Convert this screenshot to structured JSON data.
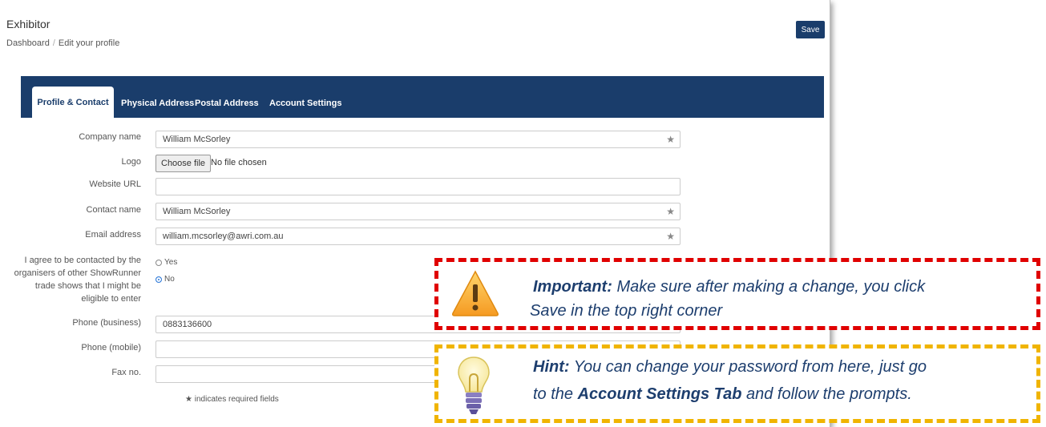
{
  "header": {
    "title": "Exhibitor",
    "breadcrumb": [
      "Dashboard",
      "Edit your profile"
    ],
    "save_label": "Save"
  },
  "tabs": [
    {
      "label": "Profile & Contact",
      "active": true
    },
    {
      "label": "Physical Address"
    },
    {
      "label": "Postal Address"
    },
    {
      "label": "Account Settings"
    }
  ],
  "form": {
    "company_name": {
      "label": "Company name",
      "value": "William McSorley"
    },
    "logo": {
      "label": "Logo",
      "button": "Choose file",
      "status": "No file chosen"
    },
    "website": {
      "label": "Website URL",
      "value": ""
    },
    "contact_name": {
      "label": "Contact name",
      "value": "William McSorley"
    },
    "email": {
      "label": "Email address",
      "value": "william.mcsorley@awri.com.au"
    },
    "agree": {
      "label": "I agree to be contacted by the organisers of other ShowRunner trade shows that I might be eligible to enter",
      "label_lines": [
        "I agree to be contacted by the",
        "organisers of other ShowRunner",
        "trade shows that I might be",
        "eligible to enter"
      ],
      "options": [
        "Yes",
        "No"
      ],
      "selected": "No"
    },
    "phone_business": {
      "label": "Phone (business)",
      "value": "0883136600"
    },
    "phone_mobile": {
      "label": "Phone (mobile)",
      "value": ""
    },
    "fax": {
      "label": "Fax no.",
      "value": ""
    },
    "required_note": "indicates required fields",
    "required_symbol": "★"
  },
  "callouts": {
    "important": {
      "title": "Important:",
      "text": "Make sure after making a change, you click",
      "text2": "Save in the top right corner",
      "icon": "warning-icon",
      "color": "#e00000"
    },
    "hint": {
      "title": "Hint:",
      "text": "You can change your password from here, just go",
      "text2a": "to the ",
      "emph": "Account Settings Tab",
      "text2b": " and follow the prompts.",
      "icon": "lightbulb-icon",
      "color": "#f0b400"
    }
  },
  "colors": {
    "brand": "#1a3d6b",
    "text_callout": "#1d3e6e"
  }
}
